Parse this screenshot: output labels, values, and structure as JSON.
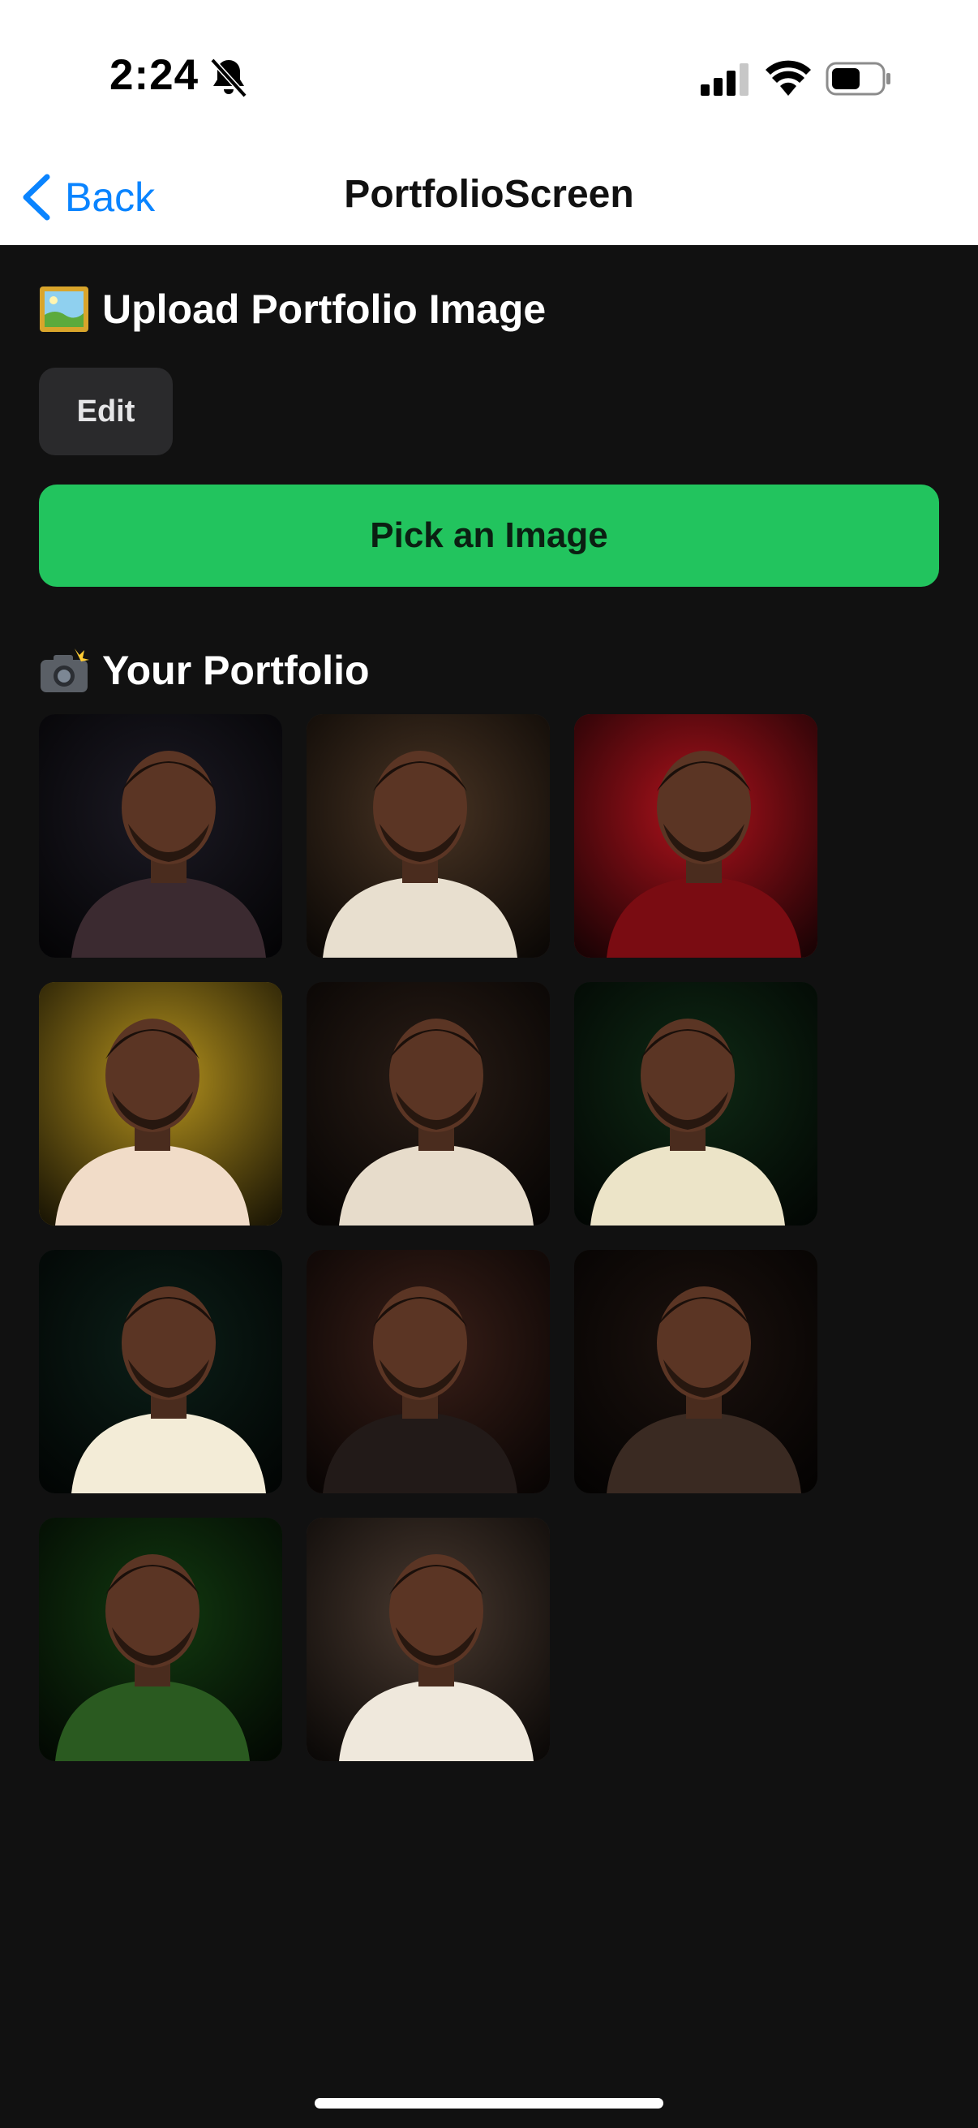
{
  "status_bar": {
    "time": "2:24",
    "icons": [
      "bell-slash-icon",
      "cellular-signal-icon",
      "wifi-icon",
      "battery-icon"
    ]
  },
  "nav": {
    "back_label": "Back",
    "title": "PortfolioScreen"
  },
  "upload_section": {
    "icon": "framed-picture-icon",
    "heading": "Upload Portfolio Image",
    "edit_label": "Edit",
    "pick_label": "Pick an Image"
  },
  "portfolio_section": {
    "icon": "camera-flash-icon",
    "heading": "Your Portfolio",
    "images": [
      {
        "name": "portfolio-image-1",
        "bg": "#1c1a24",
        "accent": "#3b2a30"
      },
      {
        "name": "portfolio-image-2",
        "bg": "#4a3524",
        "accent": "#e8dfcf"
      },
      {
        "name": "portfolio-image-3",
        "bg": "#b0121c",
        "accent": "#7a0c12"
      },
      {
        "name": "portfolio-image-4",
        "bg": "#b8951e",
        "accent": "#f1dcc8"
      },
      {
        "name": "portfolio-image-5",
        "bg": "#2a1d16",
        "accent": "#e7dccb"
      },
      {
        "name": "portfolio-image-6",
        "bg": "#0f2a15",
        "accent": "#ece4c8"
      },
      {
        "name": "portfolio-image-7",
        "bg": "#0c1f18",
        "accent": "#f3ecd7"
      },
      {
        "name": "portfolio-image-8",
        "bg": "#3a1f18",
        "accent": "#221a18"
      },
      {
        "name": "portfolio-image-9",
        "bg": "#1c120e",
        "accent": "#3a2a22"
      },
      {
        "name": "portfolio-image-10",
        "bg": "#123a10",
        "accent": "#2a5a20"
      },
      {
        "name": "portfolio-image-11",
        "bg": "#4a3a30",
        "accent": "#efe8dc"
      }
    ]
  },
  "colors": {
    "background": "#111111",
    "accent_blue": "#0a84ff",
    "pick_button": "#22c45e",
    "edit_button": "#2a2a2c"
  }
}
